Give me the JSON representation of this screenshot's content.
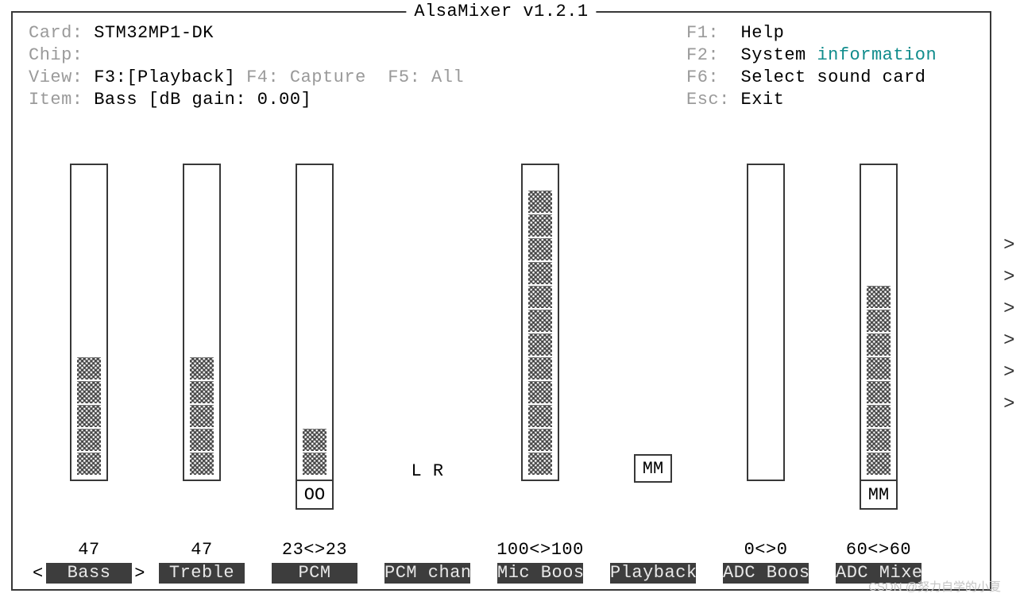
{
  "title": "AlsaMixer v1.2.1",
  "header": {
    "card_label": "Card:",
    "card_value": "STM32MP1-DK",
    "chip_label": "Chip:",
    "chip_value": "",
    "view_label": "View:",
    "view_f3": "F3:[Playback]",
    "view_f4": "F4: Capture",
    "view_f5": "F5: All",
    "item_label": "Item:",
    "item_value": "Bass [dB gain: 0.00]"
  },
  "help": {
    "f1_key": "F1:",
    "f1_txt": "Help",
    "f2_key": "F2:",
    "f2_txt_a": "System ",
    "f2_txt_b": "information",
    "f6_key": "F6:",
    "f6_txt": "Select sound card",
    "esc_key": "Esc:",
    "esc_txt": "Exit"
  },
  "sel_left": "<",
  "sel_right": ">",
  "channels": [
    {
      "name": "Bass",
      "value": "47",
      "selected": true,
      "segs": 5,
      "mute": null,
      "lr": null
    },
    {
      "name": "Treble",
      "value": "47",
      "selected": false,
      "segs": 5,
      "mute": null,
      "lr": null
    },
    {
      "name": "PCM",
      "value": "23<>23",
      "selected": false,
      "segs": 2,
      "mute": "OO",
      "lr": null
    },
    {
      "name": "PCM chan",
      "value": "",
      "selected": false,
      "segs": null,
      "mute": null,
      "lr": "L R"
    },
    {
      "name": "Mic Boos",
      "value": "100<>100",
      "selected": false,
      "segs": 12,
      "mute": null,
      "lr": null
    },
    {
      "name": "Playback",
      "value": "",
      "selected": false,
      "segs": null,
      "mute": "MM",
      "lr": null
    },
    {
      "name": "ADC Boos",
      "value": "0<>0",
      "selected": false,
      "segs": 0,
      "mute": null,
      "lr": null
    },
    {
      "name": "ADC Mixe",
      "value": "60<>60",
      "selected": false,
      "segs": 8,
      "mute": "MM",
      "lr": null
    }
  ],
  "scroll": [
    ">",
    ">",
    ">",
    ">",
    ">",
    ">"
  ],
  "watermark": "CSDN @努力自学的小夏"
}
